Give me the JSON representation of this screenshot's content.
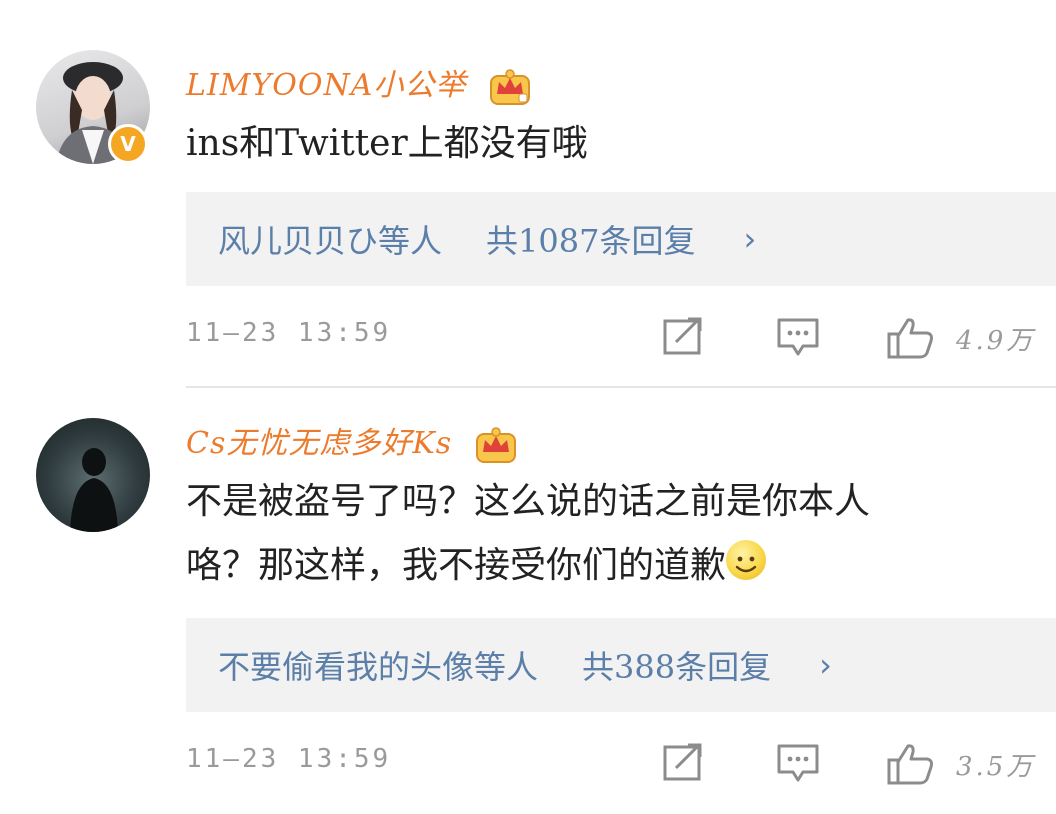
{
  "comments": [
    {
      "username": "LIMYOONA小公举",
      "content": "ins和Twitter上都没有哦",
      "reply_people": "风儿贝贝ひ等人",
      "reply_total": "共1087条回复",
      "chevron": "›",
      "timestamp": "11—23  13:59",
      "likes": "4.9万",
      "verified_badge": "V"
    },
    {
      "username": "Cs无忧无虑多好Ks",
      "content": "不是被盗号了吗？这么说的话之前是你本人咯？那这样，我不接受你们的道歉",
      "reply_people": "不要偷看我的头像等人",
      "reply_total": "共388条回复",
      "chevron": "›",
      "timestamp": "11—23  13:59",
      "likes": "3.5万"
    }
  ],
  "icons": [
    "crown-badge-icon",
    "share-icon",
    "comment-icon",
    "like-icon",
    "smile-emoji-icon"
  ],
  "colors": {
    "username": "#ec7b2d",
    "reply_link": "#5b7fa8",
    "meta": "#9a9a9a",
    "verified": "#f5a623"
  }
}
